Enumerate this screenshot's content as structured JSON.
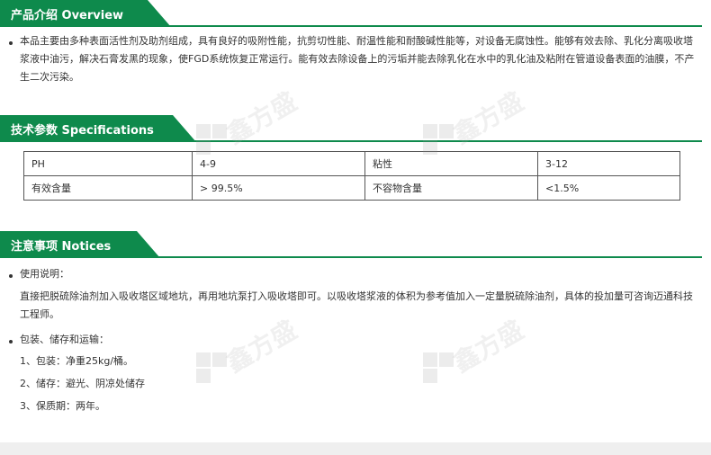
{
  "overview": {
    "title": "产品介绍  Overview",
    "text": "本品主要由多种表面活性剂及助剂组成，具有良好的吸附性能，抗剪切性能、耐温性能和耐酸碱性能等，对设备无腐蚀性。能够有效去除、乳化分离吸收塔浆液中油污，解决石膏发黑的现象，使FGD系统恢复正常运行。能有效去除设备上的污垢并能去除乳化在水中的乳化油及粘附在管道设备表面的油膜，不产生二次污染。"
  },
  "specifications": {
    "title": "技术参数  Specifications",
    "rows": [
      [
        "PH",
        "4-9",
        "粘性",
        "3-12"
      ],
      [
        "有效含量",
        "> 99.5%",
        "不容物含量",
        "<1.5%"
      ]
    ]
  },
  "notices": {
    "title": "注意事项  Notices",
    "usage_heading": "使用说明：",
    "usage_text": "直接把脱硫除油剂加入吸收塔区域地坑，再用地坑泵打入吸收塔即可。以吸收塔浆液的体积为参考值加入一定量脱硫除油剂，具体的投加量可咨询迈通科技工程师。",
    "storage_heading": "包装、储存和运输：",
    "storage_items": [
      "1、包装：净重25kg/桶。",
      "2、储存：避光、阴凉处储存",
      "3、保质期：两年。"
    ]
  },
  "watermark": {
    "text": "鑫方盛"
  },
  "colors": {
    "accent": "#0e8a4c"
  }
}
